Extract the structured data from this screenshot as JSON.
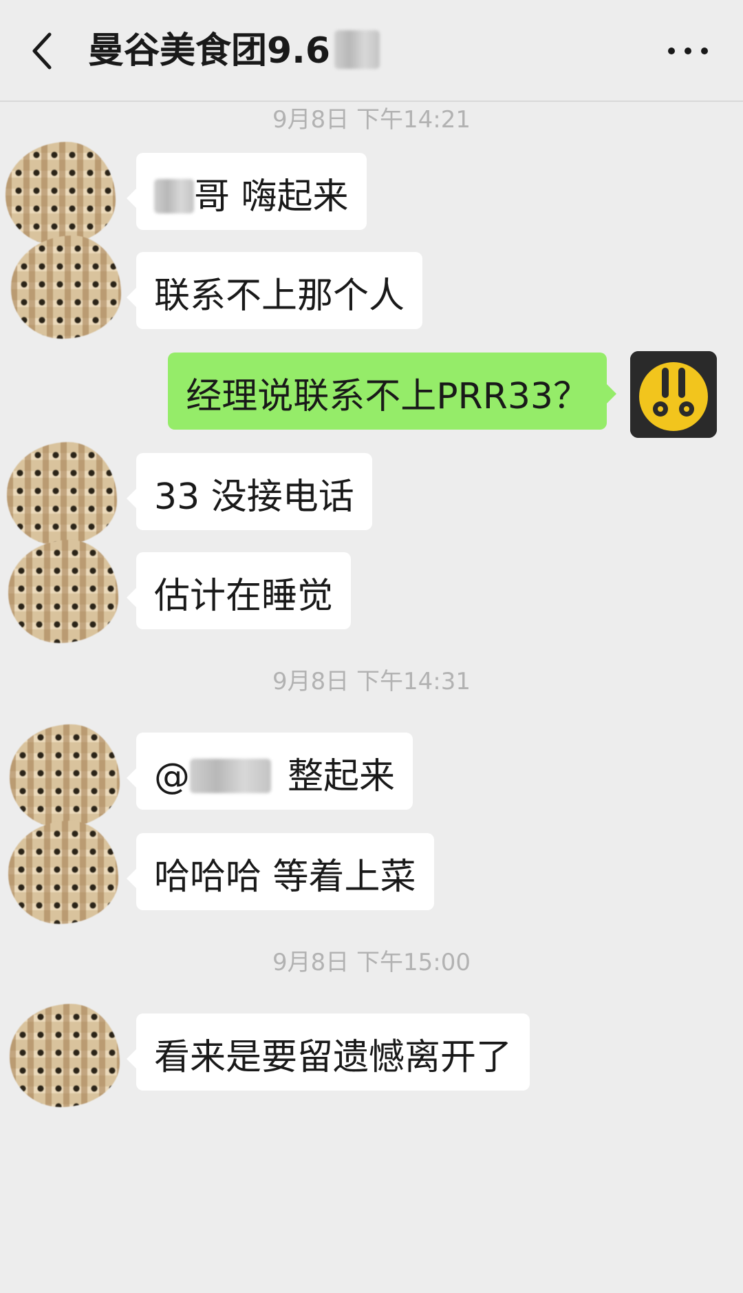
{
  "header": {
    "title": "曼谷美食团9.6"
  },
  "messages": [
    {
      "type": "time",
      "text": "9月8日 下午14:21"
    },
    {
      "type": "left",
      "redacted_prefix": true,
      "text": "哥  嗨起来"
    },
    {
      "type": "left",
      "text": "联系不上那个人"
    },
    {
      "type": "right",
      "text": "经理说联系不上PRR33？"
    },
    {
      "type": "left",
      "text": "33 没接电话"
    },
    {
      "type": "left",
      "text": "估计在睡觉"
    },
    {
      "type": "time",
      "text": "9月8日 下午14:31"
    },
    {
      "type": "left",
      "prefix": "@",
      "redacted_middle": true,
      "text": "整起来"
    },
    {
      "type": "left",
      "text": "哈哈哈 等着上菜"
    },
    {
      "type": "time",
      "text": "9月8日 下午15:00"
    },
    {
      "type": "left",
      "text": "看来是要留遗憾离开了"
    }
  ],
  "colors": {
    "background": "#ededed",
    "bubble_incoming": "#ffffff",
    "bubble_outgoing": "#95ec69",
    "timestamp": "#b2b2b2"
  },
  "icons": {
    "back": "chevron-left-icon",
    "more": "more-dots-icon",
    "self_avatar": "rabbit-face-icon"
  }
}
